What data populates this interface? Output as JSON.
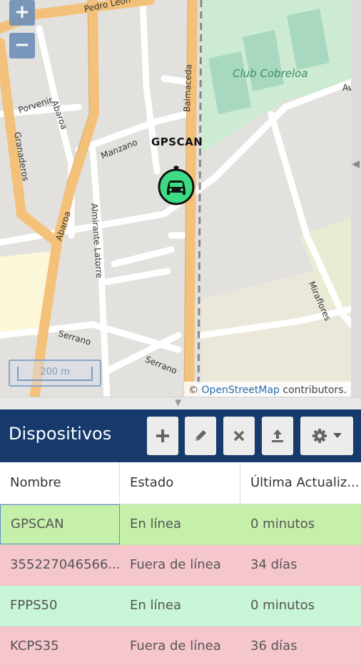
{
  "map": {
    "streets": {
      "pedro_leon": "Pedro León",
      "porvenir": "Porvenir",
      "abaroa_1": "Abaroa",
      "abaroa_2": "Abaroa",
      "granaderos": "Granaderos",
      "manzano": "Manzano",
      "balmaceda": "Balmaceda",
      "almirante_latorre": "Almirante Latorre",
      "serrano_1": "Serrano",
      "serrano_2": "Serrano",
      "miraflores": "Miraflores",
      "av": "Av"
    },
    "park_label": "Club Cobreloa",
    "vehicle_label": "GPSCAN",
    "scale_label": "200 m",
    "attribution": {
      "prefix": "©",
      "link": "OpenStreetMap",
      "suffix": "contributors."
    },
    "zoom_in": "+",
    "zoom_out": "−",
    "colors": {
      "road_major": "#f4c17a",
      "road_minor": "#ffffff",
      "park": "#cdebd2",
      "marker": "#3ddc84"
    }
  },
  "panel": {
    "title": "Dispositivos",
    "toolbar": {
      "add_icon": "plus-icon",
      "edit_icon": "pencil-icon",
      "remove_icon": "close-icon",
      "upload_icon": "upload-icon",
      "settings_icon": "gear-icon"
    }
  },
  "table": {
    "headers": [
      "Nombre",
      "Estado",
      "Última Actualiz..."
    ],
    "rows": [
      {
        "name": "GPSCAN",
        "status": "En línea",
        "updated": "0 minutos",
        "color": "#c6efaa"
      },
      {
        "name": "355227046566...",
        "status": "Fuera de línea",
        "updated": "34 días",
        "color": "#f6c6cd"
      },
      {
        "name": "FPPS50",
        "status": "En línea",
        "updated": "0 minutos",
        "color": "#c8f5d6"
      },
      {
        "name": "KCPS35",
        "status": "Fuera de línea",
        "updated": "36 días",
        "color": "#f6c6cd"
      }
    ]
  }
}
